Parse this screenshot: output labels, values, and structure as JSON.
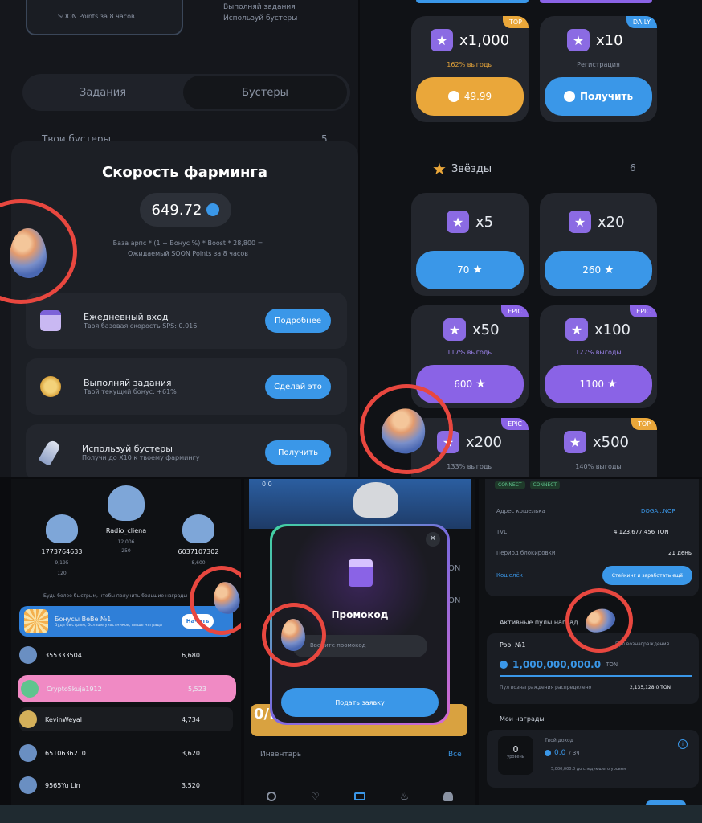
{
  "top_left": {
    "points_hint": "SOON Points за 8 часов",
    "bullets": [
      "Выполняй задания",
      "Используй бустеры"
    ],
    "tabs": [
      "Задания",
      "Бустеры"
    ],
    "section": {
      "label": "Твои бустеры",
      "count": "5"
    },
    "modal": {
      "title": "Скорость фарминга",
      "value": "649.72",
      "formula": "База арпс * (1 + Бонус %) * Boost * 28,800 = Ожидаемый SOON Points за 8 часов",
      "items": [
        {
          "title": "Ежедневный вход",
          "subtitle": "Твоя базовая скорость SPS: 0.016",
          "button": "Подробнее",
          "icon": "calendar-icon"
        },
        {
          "title": "Выполняй задания",
          "subtitle": "Твой текущий бонус: +61%",
          "button": "Сделай это",
          "icon": "medal-icon"
        },
        {
          "title": "Используй бустеры",
          "subtitle": "Получи до X10 к твоему фармингу",
          "button": "Получить",
          "icon": "rocket-icon"
        }
      ]
    }
  },
  "top_right": {
    "packs_top": [
      {
        "amount": "x1,000",
        "note": "162% выгоды",
        "button": "49.99",
        "badge": "TOP",
        "style": "orange"
      },
      {
        "amount": "x10",
        "note": "Регистрация",
        "button": "Получить",
        "badge": "DAILY",
        "style": "blue"
      }
    ],
    "stars_section": {
      "label": "Звёзды",
      "count": "6"
    },
    "packs_stars": [
      {
        "amount": "x5",
        "button": "70",
        "style": "blue"
      },
      {
        "amount": "x20",
        "button": "260",
        "style": "blue"
      },
      {
        "amount": "x50",
        "note": "117% выгоды",
        "button": "600",
        "badge": "EPIC",
        "style": "purple"
      },
      {
        "amount": "x100",
        "note": "127% выгоды",
        "button": "1100",
        "badge": "EPIC",
        "style": "purple"
      },
      {
        "amount": "x200",
        "note": "133% выгоды",
        "badge": "EPIC"
      },
      {
        "amount": "x500",
        "note": "140% выгоды",
        "badge": "TOP"
      }
    ]
  },
  "bottom_left": {
    "podium": [
      {
        "name": "1773764633",
        "stat": "9,195",
        "extra": "120"
      },
      {
        "name": "Radio_cliena",
        "stat": "12,006",
        "extra": "250"
      },
      {
        "name": "6037107302",
        "stat": "8,600",
        "extra": "110"
      }
    ],
    "hint": "Будь более быстрым, чтобы получить большие награды",
    "banner": {
      "title": "Бонусы BeBe №1",
      "subtitle": "Будь быстрым, больше участников, выше награда",
      "button": "Начать"
    },
    "rows": [
      {
        "name": "355333504",
        "value": "6,680"
      },
      {
        "name": "CryptoSkuja1912",
        "value": "5,523"
      },
      {
        "name": "KevinWeyal",
        "value": "4,734"
      },
      {
        "name": "6510636210",
        "value": "3,620"
      },
      {
        "name": "9565Yu Lin",
        "value": "3,520"
      }
    ]
  },
  "bottom_mid": {
    "version": "0.0",
    "promo": {
      "title": "Промокод",
      "placeholder": "Введите промокод",
      "button": "Подать заявку"
    },
    "inventory": "Инвентарь",
    "all": "Все",
    "side_text": "ON",
    "big_text": "0/E",
    "nav": [
      "home-icon",
      "heart-icon",
      "wallet-icon",
      "fire-icon",
      "profile-icon"
    ]
  },
  "bottom_right": {
    "tags": [
      "CONNECT",
      "CONNECT"
    ],
    "rows": [
      {
        "label": "Адрес кошелька",
        "value": "DOGA...NOP"
      },
      {
        "label": "TVL",
        "value": "4,123,677,456 TON"
      },
      {
        "label": "Период блокировки",
        "value": "21 день"
      }
    ],
    "wallet_link": "Кошелёк",
    "stake_button": "Стейкинг и заработать ещё",
    "active_label": "Активные пулы наград",
    "pool": {
      "name": "Pool №1",
      "subtitle": "Пул вознаграждения",
      "amount": "1,000,000,000.0",
      "unit": "TON",
      "footer_left": "Пул вознаграждения распределено",
      "footer_right": "2,135,128.0 TON"
    },
    "my_rewards": "Мои награды",
    "reward": {
      "count": "0",
      "count_label": "уровень",
      "title": "Твой доход",
      "value": "0.0",
      "per": "/ 3ч",
      "progress": "5,000,000.0 до следующего уровня"
    }
  },
  "colors": {
    "accent_blue": "#3a97e8",
    "accent_orange": "#eaa73a",
    "accent_purple": "#8a63e6",
    "highlight_ring": "#e8473f",
    "pink_row": "#f08ac4"
  }
}
